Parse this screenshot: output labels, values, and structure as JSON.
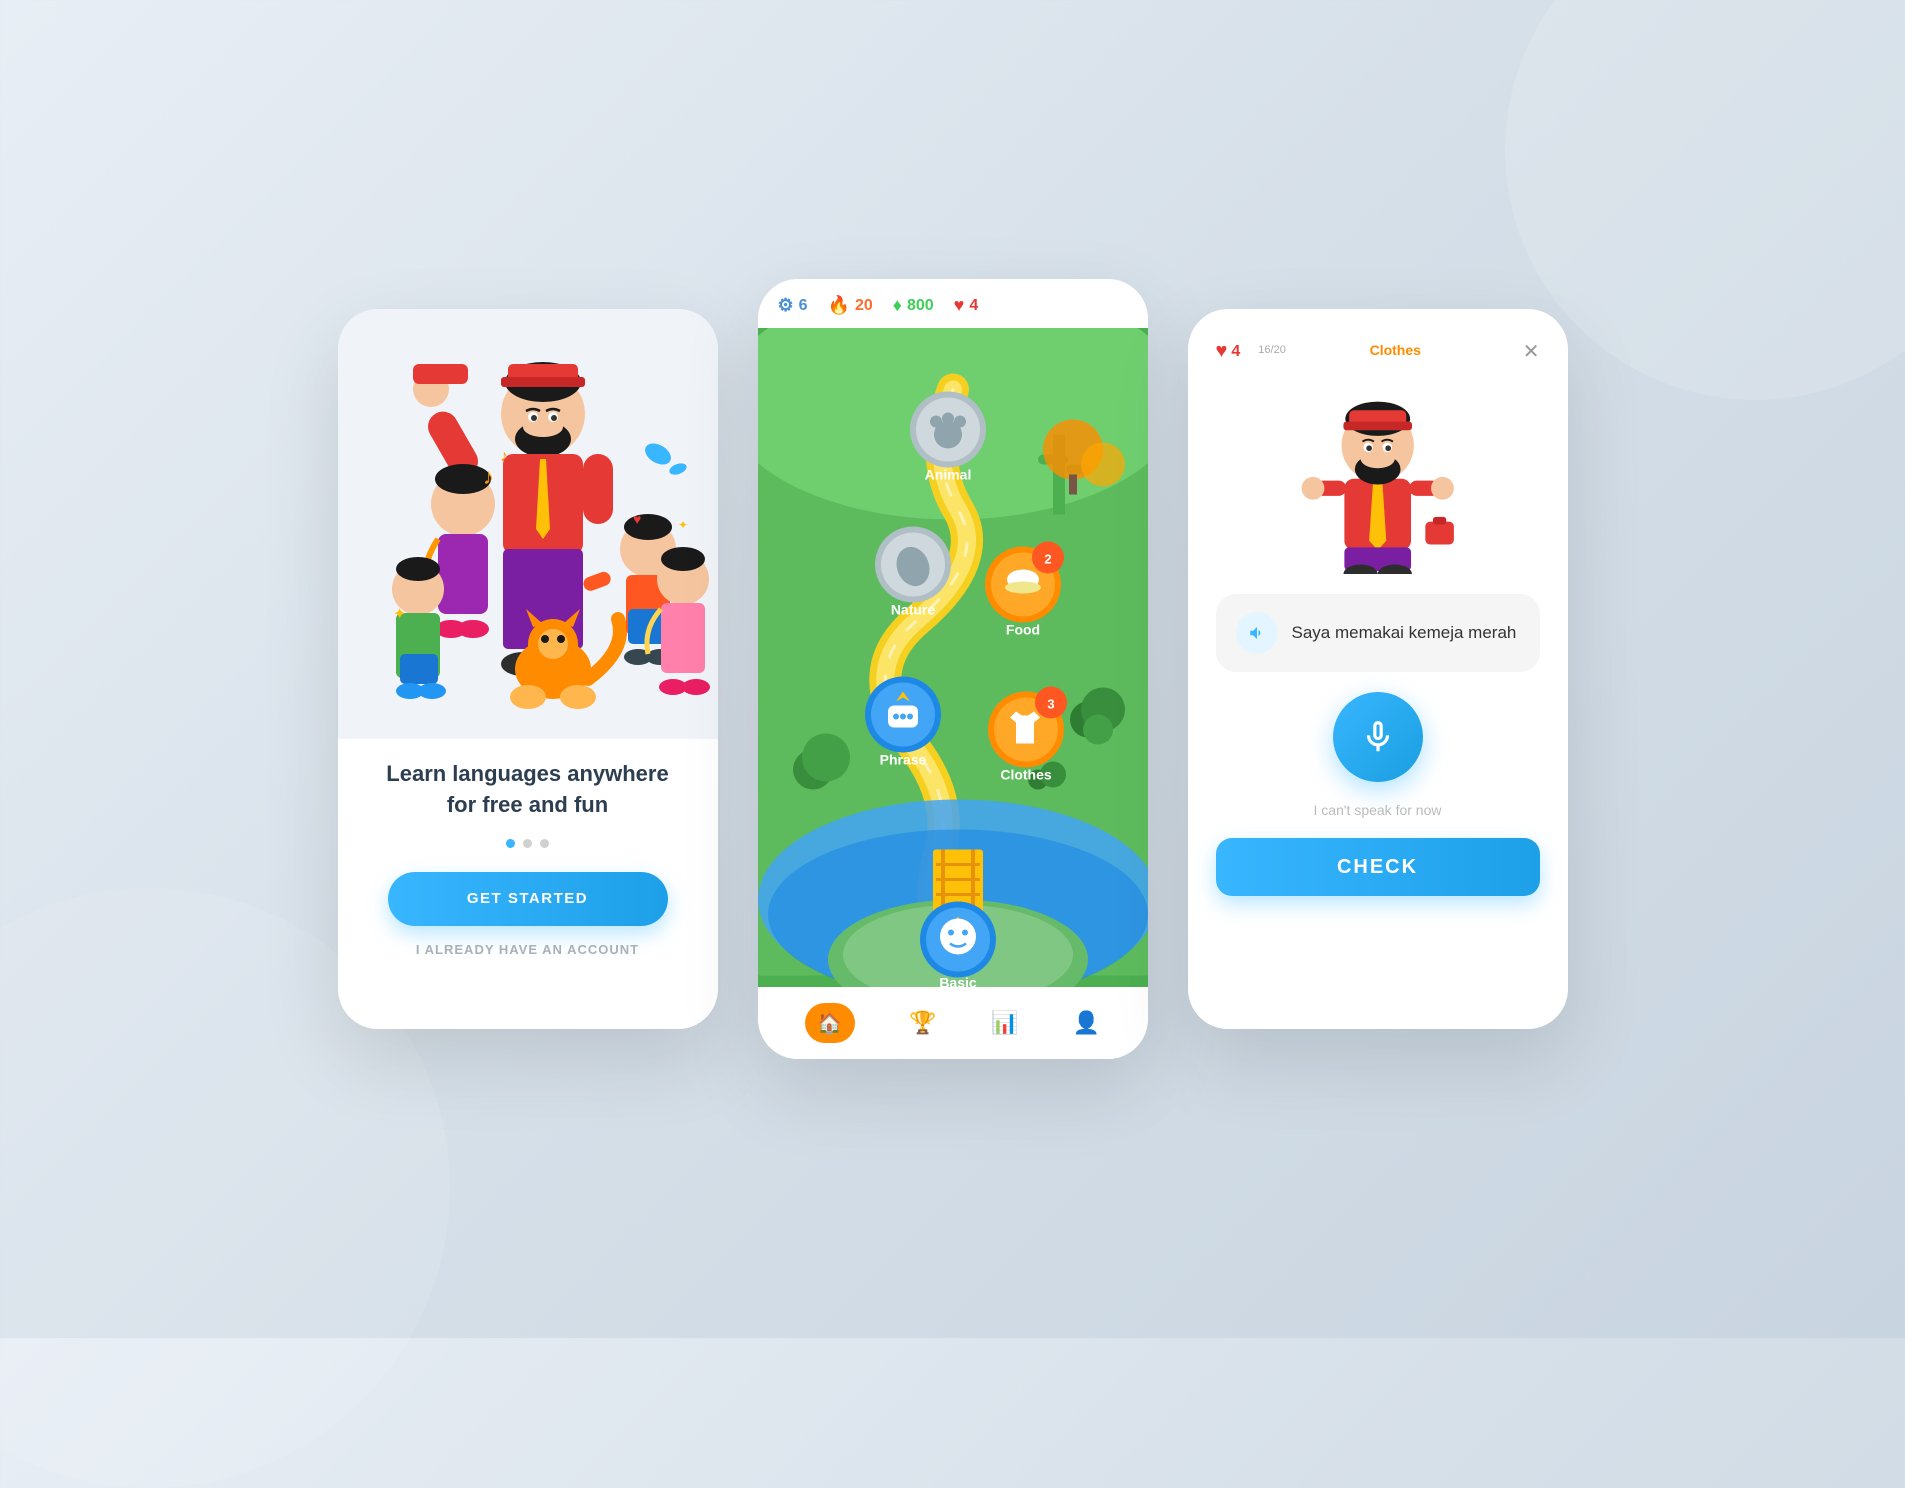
{
  "background": "#e4ecf5",
  "screen1": {
    "tagline": "Learn languages anywhere\nfor free and fun",
    "dots": [
      {
        "active": true
      },
      {
        "active": false
      },
      {
        "active": false
      }
    ],
    "cta_primary": "GET STARTED",
    "cta_secondary": "I ALREADY HAVE AN ACCOUNT"
  },
  "screen2": {
    "stats": [
      {
        "icon": "⚙",
        "value": "6",
        "color": "stat-blue"
      },
      {
        "icon": "🔥",
        "value": "20",
        "color": "stat-orange"
      },
      {
        "icon": "♦",
        "value": "800",
        "color": "stat-green"
      },
      {
        "icon": "♥",
        "value": "4",
        "color": "stat-red"
      }
    ],
    "lessons": [
      {
        "label": "Animal",
        "type": "locked"
      },
      {
        "label": "Nature",
        "type": "locked"
      },
      {
        "label": "Food",
        "type": "badge",
        "badge": "2"
      },
      {
        "label": "Phrase",
        "type": "active"
      },
      {
        "label": "Clothes",
        "type": "badge",
        "badge": "3"
      },
      {
        "label": "Basic",
        "type": "active"
      }
    ],
    "nav": [
      {
        "icon": "🏠",
        "active": true
      },
      {
        "icon": "🏆",
        "active": false
      },
      {
        "icon": "📊",
        "active": false
      },
      {
        "icon": "👤",
        "active": false
      }
    ]
  },
  "screen3": {
    "hearts": "4",
    "progress_label": "16/20",
    "lesson_title": "Clothes",
    "progress_pct": 80,
    "sentence": "Saya memakai kemeja merah",
    "skip_text": "I can't speak for now",
    "check_label": "CHECK"
  }
}
